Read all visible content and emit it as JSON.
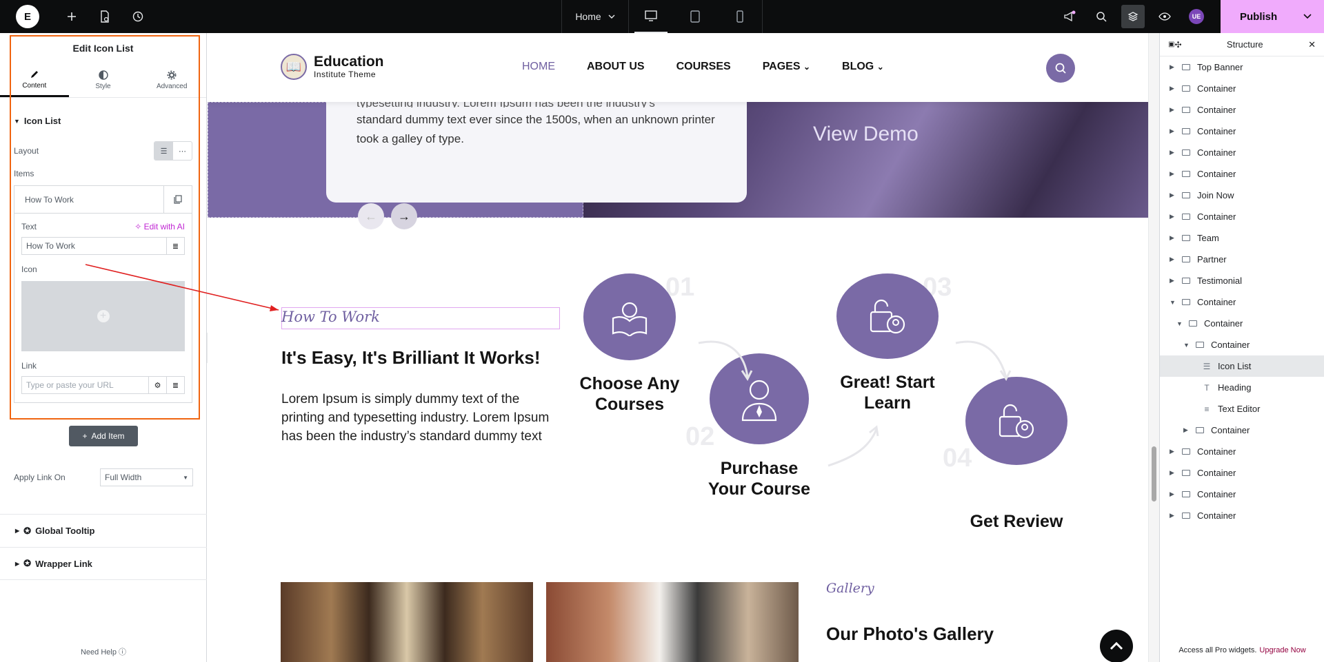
{
  "topbar": {
    "page_name": "Home",
    "publish_label": "Publish",
    "avatar_initials": "UE"
  },
  "left_panel": {
    "title": "Edit Icon List",
    "tabs": [
      {
        "label": "Content"
      },
      {
        "label": "Style"
      },
      {
        "label": "Advanced"
      }
    ],
    "section_title": "Icon List",
    "layout_label": "Layout",
    "items_label": "Items",
    "item_title": "How To Work",
    "text_label": "Text",
    "edit_ai_label": "Edit with AI",
    "text_value": "How To Work",
    "icon_label": "Icon",
    "link_label": "Link",
    "link_placeholder": "Type or paste your URL",
    "add_item_label": "Add Item",
    "apply_link_label": "Apply Link On",
    "apply_link_value": "Full Width",
    "global_tooltip_label": "Global Tooltip",
    "wrapper_link_label": "Wrapper Link",
    "need_help_label": "Need Help"
  },
  "canvas": {
    "brand_name": "Education",
    "brand_sub": "Institute Theme",
    "menu": [
      {
        "label": "HOME"
      },
      {
        "label": "ABOUT US"
      },
      {
        "label": "COURSES"
      },
      {
        "label": "PAGES"
      },
      {
        "label": "BLOG"
      }
    ],
    "hero_text_top": "typesetting industry. Lorem Ipsum has been the industry's",
    "hero_text": "standard dummy text ever since the 1500s, when an unknown printer took a galley of type.",
    "view_demo": "View Demo",
    "section_sub": "How To Work",
    "section_title": "It's Easy, It's Brilliant It Works!",
    "section_desc": "Lorem Ipsum is simply dummy text of the printing and typesetting industry. Lorem Ipsum has been the industry’s standard dummy text",
    "steps": [
      {
        "num": "01",
        "label": "Choose Any Courses"
      },
      {
        "num": "02",
        "label": "Purchase Your Course"
      },
      {
        "num": "03",
        "label": "Great! Start Learn"
      },
      {
        "num": "04",
        "label": "Get Review"
      }
    ],
    "gallery_sub": "Gallery",
    "gallery_title": "Our Photo's Gallery"
  },
  "structure": {
    "title": "Structure",
    "items": [
      {
        "label": "Top Banner"
      },
      {
        "label": "Container"
      },
      {
        "label": "Container"
      },
      {
        "label": "Container"
      },
      {
        "label": "Container"
      },
      {
        "label": "Container"
      },
      {
        "label": "Join Now"
      },
      {
        "label": "Container"
      },
      {
        "label": "Team"
      },
      {
        "label": "Partner"
      },
      {
        "label": "Testimonial"
      },
      {
        "label": "Container"
      },
      {
        "label": "Container"
      },
      {
        "label": "Container"
      },
      {
        "label": "Icon List"
      },
      {
        "label": "Heading"
      },
      {
        "label": "Text Editor"
      },
      {
        "label": "Container"
      },
      {
        "label": "Container"
      },
      {
        "label": "Container"
      },
      {
        "label": "Container"
      },
      {
        "label": "Container"
      }
    ],
    "footer_text": "Access all Pro widgets.",
    "footer_link": "Upgrade Now"
  },
  "colors": {
    "accent": "#7a6aa6",
    "publish": "#f0abfc",
    "ai": "#c026d3",
    "selection_outline": "#f0640f"
  }
}
